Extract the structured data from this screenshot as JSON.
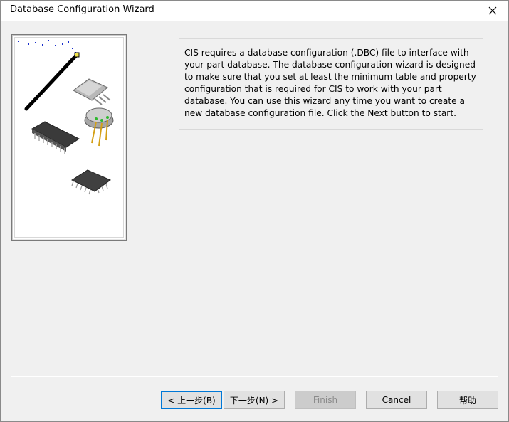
{
  "window": {
    "title": "Database Configuration Wizard"
  },
  "description": "CIS requires a database configuration (.DBC) file to interface with your part database. The database configuration wizard is designed to make sure that you set at least the minimum table and property configuration that is required for CIS to work with your part database. You can use this wizard any time you want to create a new database configuration file. Click the Next button to start.",
  "buttons": {
    "back": "< 上一步(B)",
    "next": "下一步(N) >",
    "finish": "Finish",
    "cancel": "Cancel",
    "help": "帮助"
  },
  "icons": {
    "close": "close-icon",
    "illustration": "electronic-components-illustration"
  },
  "colors": {
    "default_button_border": "#0078d7",
    "dialog_background": "#f0f0f0"
  }
}
